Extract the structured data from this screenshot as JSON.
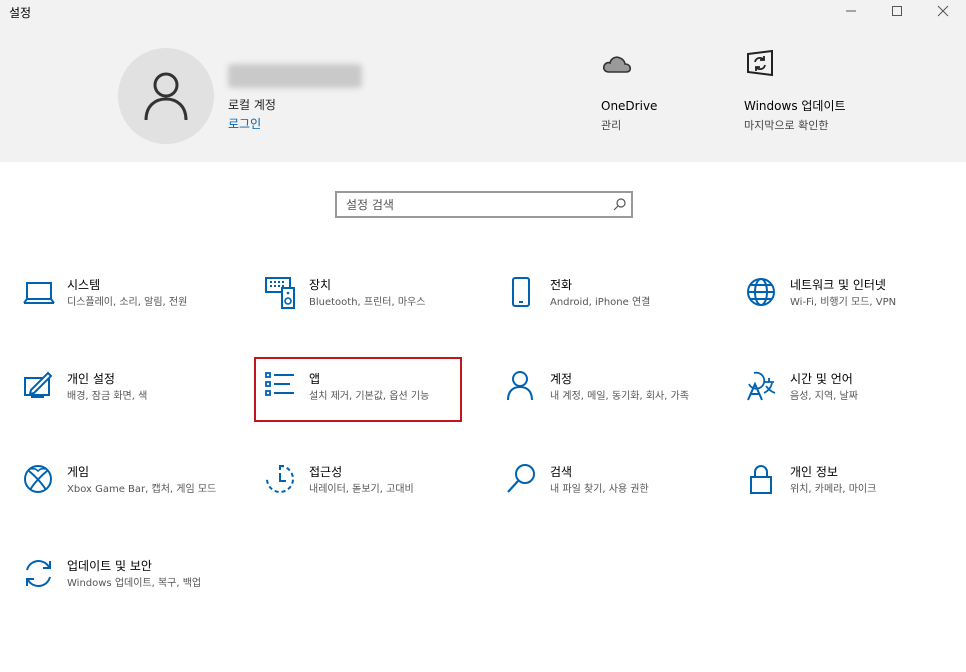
{
  "window": {
    "title": "설정"
  },
  "account": {
    "type": "로컬 계정",
    "login_link": "로그인"
  },
  "quick_links": [
    {
      "name": "onedrive",
      "title": "OneDrive",
      "subtitle": "관리",
      "icon": "cloud-icon"
    },
    {
      "name": "windows-update",
      "title": "Windows 업데이트",
      "subtitle": "마지막으로 확인한",
      "icon": "sync-icon"
    }
  ],
  "search": {
    "placeholder": "설정 검색"
  },
  "tiles": [
    {
      "id": "system",
      "title": "시스템",
      "desc": "디스플레이, 소리, 알림, 전원",
      "icon": "laptop-icon"
    },
    {
      "id": "devices",
      "title": "장치",
      "desc": "Bluetooth, 프린터, 마우스",
      "icon": "devices-icon"
    },
    {
      "id": "phone",
      "title": "전화",
      "desc": "Android, iPhone 연결",
      "icon": "phone-icon"
    },
    {
      "id": "network",
      "title": "네트워크 및 인터넷",
      "desc": "Wi-Fi, 비행기 모드, VPN",
      "icon": "globe-icon"
    },
    {
      "id": "personalization",
      "title": "개인 설정",
      "desc": "배경, 잠금 화면, 색",
      "icon": "paint-icon"
    },
    {
      "id": "apps",
      "title": "앱",
      "desc": "설치 제거, 기본값, 옵션 기능",
      "icon": "apps-list-icon"
    },
    {
      "id": "accounts",
      "title": "계정",
      "desc": "내 계정, 메일, 동기화, 회사, 가족",
      "icon": "person-icon"
    },
    {
      "id": "time-language",
      "title": "시간 및 언어",
      "desc": "음성, 지역, 날짜",
      "icon": "language-icon"
    },
    {
      "id": "gaming",
      "title": "게임",
      "desc": "Xbox Game Bar, 캡처, 게임 모드",
      "icon": "xbox-icon"
    },
    {
      "id": "ease-of-access",
      "title": "접근성",
      "desc": "내레이터, 돋보기, 고대비",
      "icon": "ease-of-access-icon"
    },
    {
      "id": "search",
      "title": "검색",
      "desc": "내 파일 찾기, 사용 권한",
      "icon": "search-icon"
    },
    {
      "id": "privacy",
      "title": "개인 정보",
      "desc": "위치, 카메라, 마이크",
      "icon": "lock-icon"
    },
    {
      "id": "update-security",
      "title": "업데이트 및 보안",
      "desc": "Windows 업데이트, 복구, 백업",
      "icon": "refresh-icon"
    }
  ],
  "colors": {
    "accent": "#0063b1",
    "highlight": "#c0171e",
    "header_bg": "#f2f2f2"
  }
}
